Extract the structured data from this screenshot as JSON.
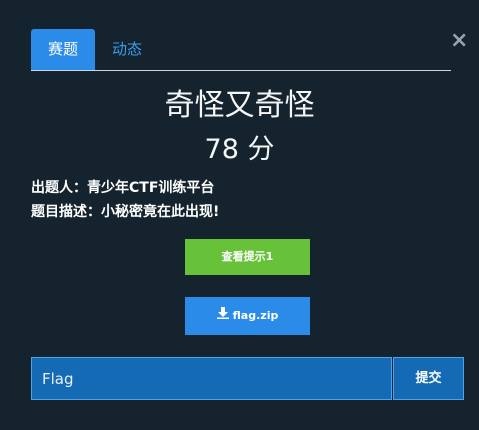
{
  "tabs": [
    {
      "label": "赛题",
      "active": true
    },
    {
      "label": "动态",
      "active": false
    }
  ],
  "close_icon": "close-icon",
  "challenge": {
    "title": "奇怪又奇怪",
    "points": "78 分",
    "author_line": "出题人：青少年CTF训练平台",
    "description_line": "题目描述：小秘密竟在此出现!"
  },
  "buttons": {
    "hint_label": "查看提示1",
    "file_label": "flag.zip",
    "file_icon": "download-icon",
    "submit_label": "提交"
  },
  "flag_input": {
    "placeholder": "Flag",
    "value": ""
  },
  "colors": {
    "background": "#14232d",
    "accent_blue": "#2b8be8",
    "hint_green": "#67c23a",
    "input_blue": "#146ab4"
  }
}
